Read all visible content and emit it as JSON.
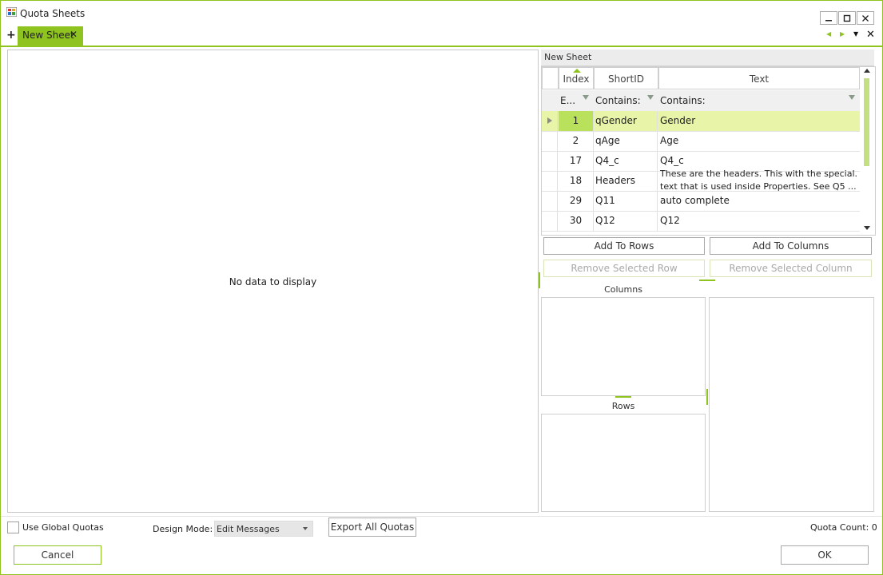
{
  "window": {
    "title": "Quota Sheets"
  },
  "tabs": {
    "add_label": "+",
    "items": [
      {
        "label": "New Sheet",
        "close": "✕"
      }
    ],
    "close_all": "✕"
  },
  "left_panel": {
    "empty_text": "No data to display"
  },
  "right_panel": {
    "header": "New Sheet",
    "grid": {
      "columns": [
        "Index",
        "ShortID",
        "Text"
      ],
      "filters": [
        "E...",
        "Contains:",
        "Contains:"
      ],
      "rows": [
        {
          "index": "1",
          "short_id": "qGender",
          "text": "Gender"
        },
        {
          "index": "2",
          "short_id": "qAge",
          "text": "Age"
        },
        {
          "index": "17",
          "short_id": "Q4_c",
          "text": "Q4_c"
        },
        {
          "index": "18",
          "short_id": "Headers",
          "text": "These are the headers. This with the special... text that is used inside Properties. See Q5 ..."
        },
        {
          "index": "29",
          "short_id": "Q11",
          "text": "auto complete"
        },
        {
          "index": "30",
          "short_id": "Q12",
          "text": "Q12"
        }
      ],
      "headers_text_line1": "These are the headers. This with the special...",
      "headers_text_line2": "text that is used inside Properties. See Q5 ..."
    },
    "buttons": {
      "add_to_rows": "Add To Rows",
      "add_to_columns": "Add To Columns",
      "remove_row": "Remove Selected Row",
      "remove_column": "Remove Selected Column"
    },
    "columns_caption": "Columns",
    "rows_caption": "Rows"
  },
  "footer": {
    "use_global_quotas": "Use Global Quotas",
    "design_mode_label": "Design Mode:",
    "design_mode_value": "Edit Messages",
    "export_all": "Export All Quotas",
    "quota_count": "Quota Count: 0",
    "cancel": "Cancel",
    "ok": "OK"
  },
  "colors": {
    "accent": "#8fc31f",
    "selected_row": "#e8f5a8",
    "selected_cell": "#b9e15b"
  }
}
